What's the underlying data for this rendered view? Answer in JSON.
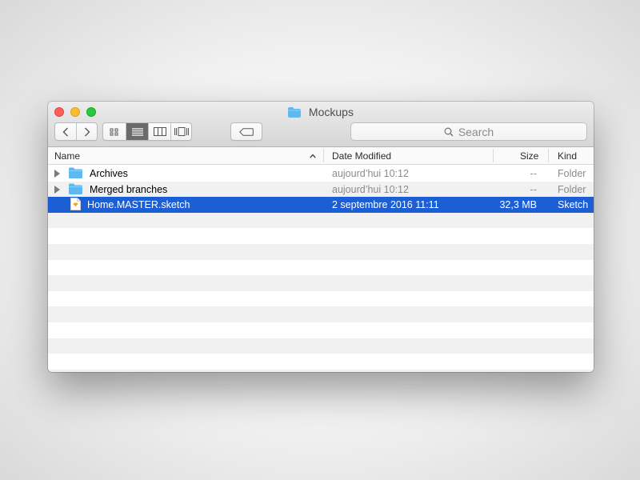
{
  "window": {
    "title": "Mockups",
    "search_placeholder": "Search"
  },
  "columns": {
    "name": "Name",
    "date_modified": "Date Modified",
    "size": "Size",
    "kind": "Kind"
  },
  "files": [
    {
      "name": "Archives",
      "date": "aujourd’hui 10:12",
      "size": "--",
      "kind": "Folder",
      "type": "folder",
      "expandable": true,
      "selected": false
    },
    {
      "name": "Merged branches",
      "date": "aujourd’hui 10:12",
      "size": "--",
      "kind": "Folder",
      "type": "folder",
      "expandable": true,
      "selected": false
    },
    {
      "name": "Home.MASTER.sketch",
      "date": "2 septembre 2016 11:11",
      "size": "32,3 MB",
      "kind": "Sketch",
      "type": "sketch-file",
      "expandable": false,
      "selected": true
    }
  ],
  "toolbar": {
    "back_icon": "chevron-left-icon",
    "forward_icon": "chevron-right-icon",
    "view_icons": [
      "icon-view-icon",
      "list-view-icon",
      "column-view-icon",
      "cover-flow-icon"
    ],
    "active_view": "list-view-icon",
    "tag_icon": "tag-icon"
  },
  "colors": {
    "selection": "#1c5fd4",
    "folder": "#5fb8ee",
    "close": "#fc5f57",
    "minimize": "#fdbc2e",
    "maximize": "#2ac840"
  }
}
